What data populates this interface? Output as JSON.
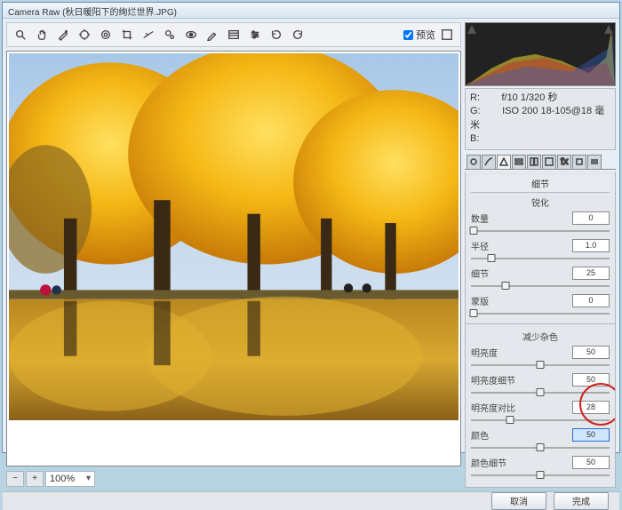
{
  "window": {
    "title": "Camera Raw (秋日暖阳下的绚烂世界.JPG)"
  },
  "toolbar": {
    "preview_label": "预览"
  },
  "zoom": {
    "level": "100%"
  },
  "exif": {
    "line1_label": "R:",
    "line1_value": "f/10  1/320 秒",
    "line2_label": "G:",
    "line2_value": "ISO 200  18-105@18 毫米",
    "line3_label": "B:"
  },
  "panel": {
    "title": "细节"
  },
  "sections": {
    "sharpen": {
      "heading": "锐化"
    },
    "noise": {
      "heading": "减少杂色"
    }
  },
  "sliders": {
    "amount": {
      "label": "数量",
      "value": "0",
      "pos": 2
    },
    "radius": {
      "label": "半径",
      "value": "1.0",
      "pos": 15
    },
    "detail": {
      "label": "细节",
      "value": "25",
      "pos": 25
    },
    "masking": {
      "label": "蒙版",
      "value": "0",
      "pos": 2
    },
    "luminance": {
      "label": "明亮度",
      "value": "50",
      "pos": 50
    },
    "lum_detail": {
      "label": "明亮度细节",
      "value": "50",
      "pos": 50
    },
    "lum_contrast": {
      "label": "明亮度对比",
      "value": "28",
      "pos": 28
    },
    "color": {
      "label": "颜色",
      "value": "50",
      "pos": 50,
      "highlighted": true
    },
    "color_detail": {
      "label": "颜色细节",
      "value": "50",
      "pos": 50
    }
  },
  "footer": {
    "cancel": "取消",
    "done": "完成"
  }
}
